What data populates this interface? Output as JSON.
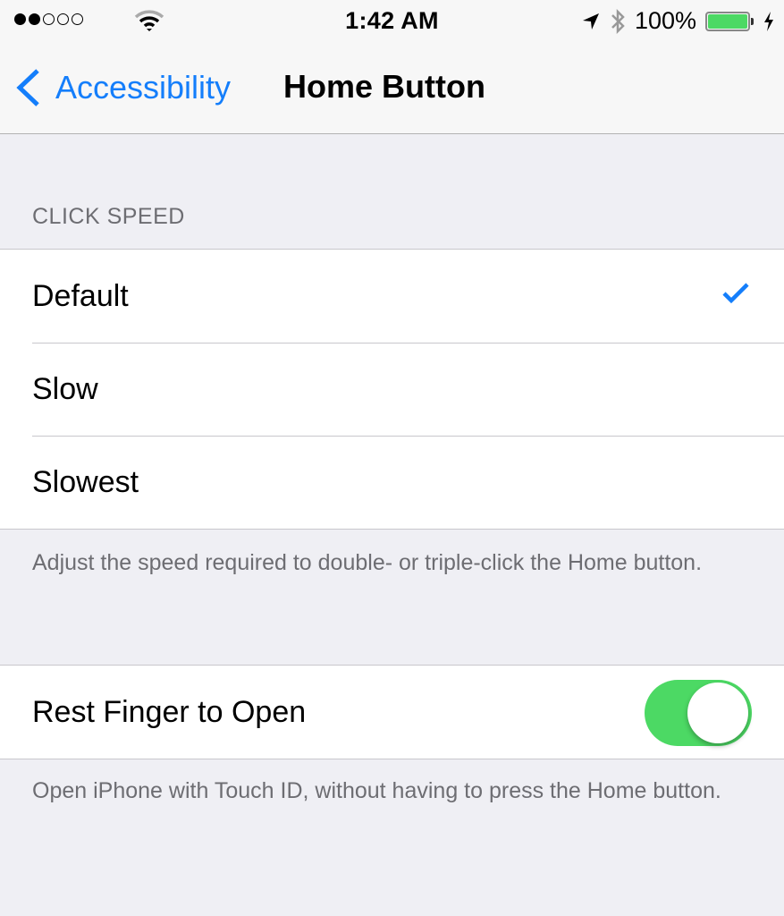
{
  "status_bar": {
    "signal_filled": 2,
    "signal_total": 5,
    "time": "1:42 AM",
    "battery_percent_label": "100%",
    "battery_level": 1.0,
    "charging": true,
    "icons": [
      "signal-dots-icon",
      "wifi-icon",
      "location-arrow-icon",
      "bluetooth-icon",
      "battery-icon",
      "charging-bolt-icon"
    ]
  },
  "nav": {
    "back_label": "Accessibility",
    "title": "Home Button"
  },
  "click_speed": {
    "header": "CLICK SPEED",
    "options": [
      {
        "label": "Default",
        "selected": true
      },
      {
        "label": "Slow",
        "selected": false
      },
      {
        "label": "Slowest",
        "selected": false
      }
    ],
    "footer": "Adjust the speed required to double- or triple-click the Home button."
  },
  "rest_finger": {
    "label": "Rest Finger to Open",
    "enabled": true,
    "footer": "Open iPhone with Touch ID, without having to press the Home button."
  },
  "colors": {
    "accent": "#147efb",
    "toggle_on": "#4cd964",
    "background": "#efeff4",
    "secondary_text": "#6d6d72"
  }
}
